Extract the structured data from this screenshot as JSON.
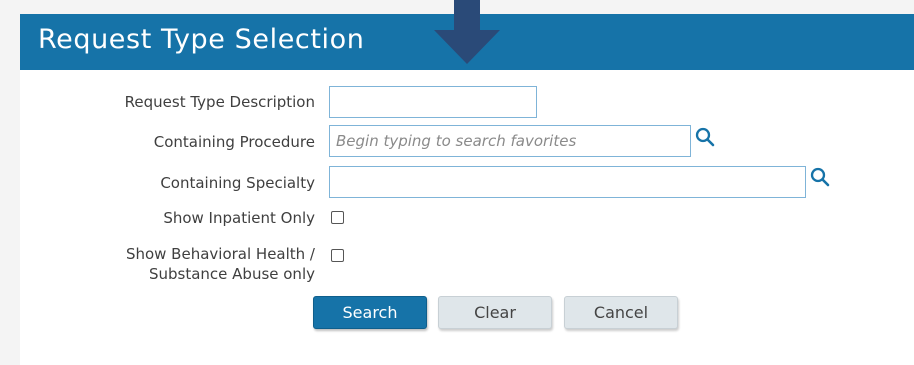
{
  "header": {
    "title": "Request Type Selection"
  },
  "form": {
    "request_type_description": {
      "label": "Request Type Description",
      "value": ""
    },
    "containing_procedure": {
      "label": "Containing Procedure",
      "value": "",
      "placeholder": "Begin typing to search favorites",
      "icon": "search-icon"
    },
    "containing_specialty": {
      "label": "Containing Specialty",
      "value": "",
      "icon": "search-icon"
    },
    "show_inpatient_only": {
      "label": "Show Inpatient Only",
      "checked": false
    },
    "show_behavioral_health": {
      "label_line1": "Show Behavioral Health /",
      "label_line2": "Substance Abuse only",
      "checked": false
    }
  },
  "buttons": {
    "search": "Search",
    "clear": "Clear",
    "cancel": "Cancel"
  },
  "colors": {
    "header_bg": "#1673a8",
    "arrow": "#2a4a78",
    "field_border": "#7fb4d8"
  }
}
